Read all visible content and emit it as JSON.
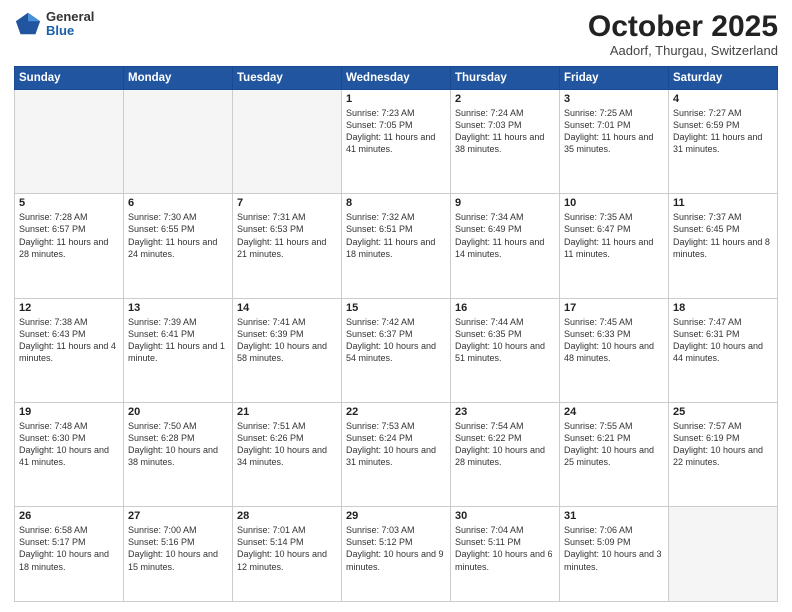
{
  "header": {
    "logo_general": "General",
    "logo_blue": "Blue",
    "month_title": "October 2025",
    "location": "Aadorf, Thurgau, Switzerland"
  },
  "weekdays": [
    "Sunday",
    "Monday",
    "Tuesday",
    "Wednesday",
    "Thursday",
    "Friday",
    "Saturday"
  ],
  "weeks": [
    [
      {
        "day": "",
        "text": ""
      },
      {
        "day": "",
        "text": ""
      },
      {
        "day": "",
        "text": ""
      },
      {
        "day": "1",
        "text": "Sunrise: 7:23 AM\nSunset: 7:05 PM\nDaylight: 11 hours and 41 minutes."
      },
      {
        "day": "2",
        "text": "Sunrise: 7:24 AM\nSunset: 7:03 PM\nDaylight: 11 hours and 38 minutes."
      },
      {
        "day": "3",
        "text": "Sunrise: 7:25 AM\nSunset: 7:01 PM\nDaylight: 11 hours and 35 minutes."
      },
      {
        "day": "4",
        "text": "Sunrise: 7:27 AM\nSunset: 6:59 PM\nDaylight: 11 hours and 31 minutes."
      }
    ],
    [
      {
        "day": "5",
        "text": "Sunrise: 7:28 AM\nSunset: 6:57 PM\nDaylight: 11 hours and 28 minutes."
      },
      {
        "day": "6",
        "text": "Sunrise: 7:30 AM\nSunset: 6:55 PM\nDaylight: 11 hours and 24 minutes."
      },
      {
        "day": "7",
        "text": "Sunrise: 7:31 AM\nSunset: 6:53 PM\nDaylight: 11 hours and 21 minutes."
      },
      {
        "day": "8",
        "text": "Sunrise: 7:32 AM\nSunset: 6:51 PM\nDaylight: 11 hours and 18 minutes."
      },
      {
        "day": "9",
        "text": "Sunrise: 7:34 AM\nSunset: 6:49 PM\nDaylight: 11 hours and 14 minutes."
      },
      {
        "day": "10",
        "text": "Sunrise: 7:35 AM\nSunset: 6:47 PM\nDaylight: 11 hours and 11 minutes."
      },
      {
        "day": "11",
        "text": "Sunrise: 7:37 AM\nSunset: 6:45 PM\nDaylight: 11 hours and 8 minutes."
      }
    ],
    [
      {
        "day": "12",
        "text": "Sunrise: 7:38 AM\nSunset: 6:43 PM\nDaylight: 11 hours and 4 minutes."
      },
      {
        "day": "13",
        "text": "Sunrise: 7:39 AM\nSunset: 6:41 PM\nDaylight: 11 hours and 1 minute."
      },
      {
        "day": "14",
        "text": "Sunrise: 7:41 AM\nSunset: 6:39 PM\nDaylight: 10 hours and 58 minutes."
      },
      {
        "day": "15",
        "text": "Sunrise: 7:42 AM\nSunset: 6:37 PM\nDaylight: 10 hours and 54 minutes."
      },
      {
        "day": "16",
        "text": "Sunrise: 7:44 AM\nSunset: 6:35 PM\nDaylight: 10 hours and 51 minutes."
      },
      {
        "day": "17",
        "text": "Sunrise: 7:45 AM\nSunset: 6:33 PM\nDaylight: 10 hours and 48 minutes."
      },
      {
        "day": "18",
        "text": "Sunrise: 7:47 AM\nSunset: 6:31 PM\nDaylight: 10 hours and 44 minutes."
      }
    ],
    [
      {
        "day": "19",
        "text": "Sunrise: 7:48 AM\nSunset: 6:30 PM\nDaylight: 10 hours and 41 minutes."
      },
      {
        "day": "20",
        "text": "Sunrise: 7:50 AM\nSunset: 6:28 PM\nDaylight: 10 hours and 38 minutes."
      },
      {
        "day": "21",
        "text": "Sunrise: 7:51 AM\nSunset: 6:26 PM\nDaylight: 10 hours and 34 minutes."
      },
      {
        "day": "22",
        "text": "Sunrise: 7:53 AM\nSunset: 6:24 PM\nDaylight: 10 hours and 31 minutes."
      },
      {
        "day": "23",
        "text": "Sunrise: 7:54 AM\nSunset: 6:22 PM\nDaylight: 10 hours and 28 minutes."
      },
      {
        "day": "24",
        "text": "Sunrise: 7:55 AM\nSunset: 6:21 PM\nDaylight: 10 hours and 25 minutes."
      },
      {
        "day": "25",
        "text": "Sunrise: 7:57 AM\nSunset: 6:19 PM\nDaylight: 10 hours and 22 minutes."
      }
    ],
    [
      {
        "day": "26",
        "text": "Sunrise: 6:58 AM\nSunset: 5:17 PM\nDaylight: 10 hours and 18 minutes."
      },
      {
        "day": "27",
        "text": "Sunrise: 7:00 AM\nSunset: 5:16 PM\nDaylight: 10 hours and 15 minutes."
      },
      {
        "day": "28",
        "text": "Sunrise: 7:01 AM\nSunset: 5:14 PM\nDaylight: 10 hours and 12 minutes."
      },
      {
        "day": "29",
        "text": "Sunrise: 7:03 AM\nSunset: 5:12 PM\nDaylight: 10 hours and 9 minutes."
      },
      {
        "day": "30",
        "text": "Sunrise: 7:04 AM\nSunset: 5:11 PM\nDaylight: 10 hours and 6 minutes."
      },
      {
        "day": "31",
        "text": "Sunrise: 7:06 AM\nSunset: 5:09 PM\nDaylight: 10 hours and 3 minutes."
      },
      {
        "day": "",
        "text": ""
      }
    ]
  ]
}
